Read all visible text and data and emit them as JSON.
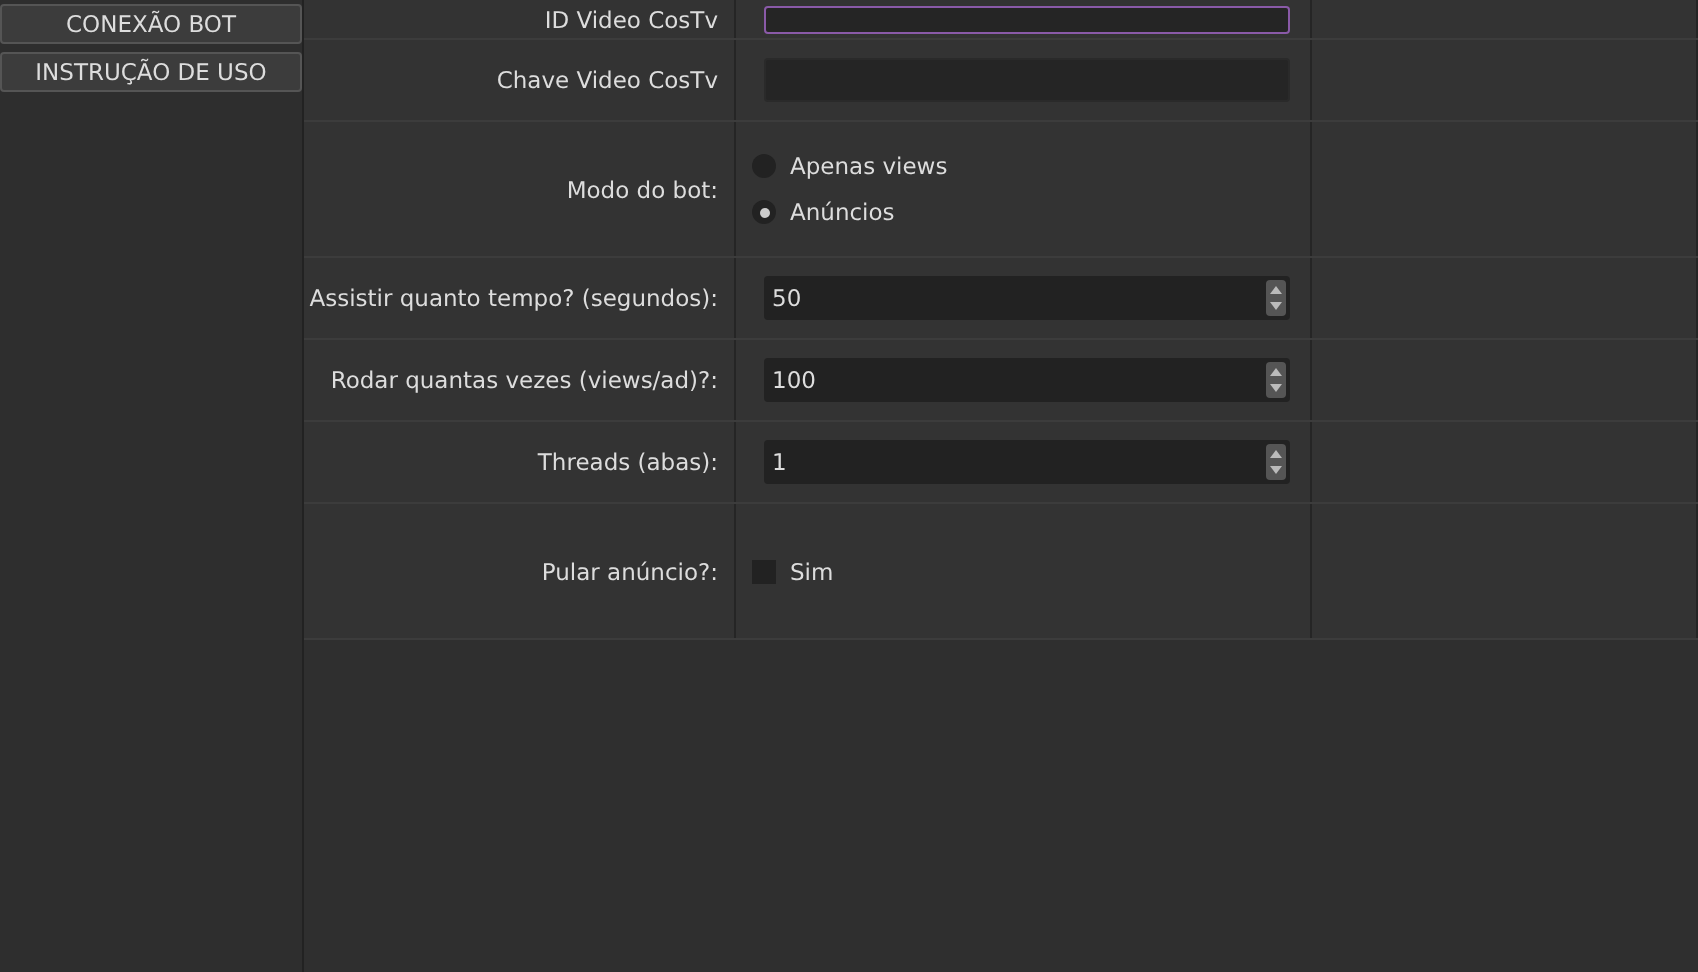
{
  "sidebar": {
    "buttons": [
      "CONEXÃO BOT",
      "INSTRUÇÃO DE USO"
    ]
  },
  "form": {
    "rows": [
      {
        "kind": "text",
        "label": "ID Video CosTv",
        "value": "",
        "focused": true
      },
      {
        "kind": "text",
        "label": "Chave Video CosTv",
        "value": "",
        "focused": false
      },
      {
        "kind": "radio",
        "label": "Modo do bot:",
        "options": [
          {
            "label": "Apenas views",
            "selected": false
          },
          {
            "label": "Anúncios",
            "selected": true
          }
        ]
      },
      {
        "kind": "spin",
        "label": "Assistir quanto tempo? (segundos):",
        "value": "50"
      },
      {
        "kind": "spin",
        "label": "Rodar quantas vezes (views/ad)?:",
        "value": "100"
      },
      {
        "kind": "spin",
        "label": "Threads (abas):",
        "value": "1"
      },
      {
        "kind": "checkbox",
        "label": "Pular anúncio?:",
        "text": "Sim",
        "checked": false
      }
    ]
  }
}
